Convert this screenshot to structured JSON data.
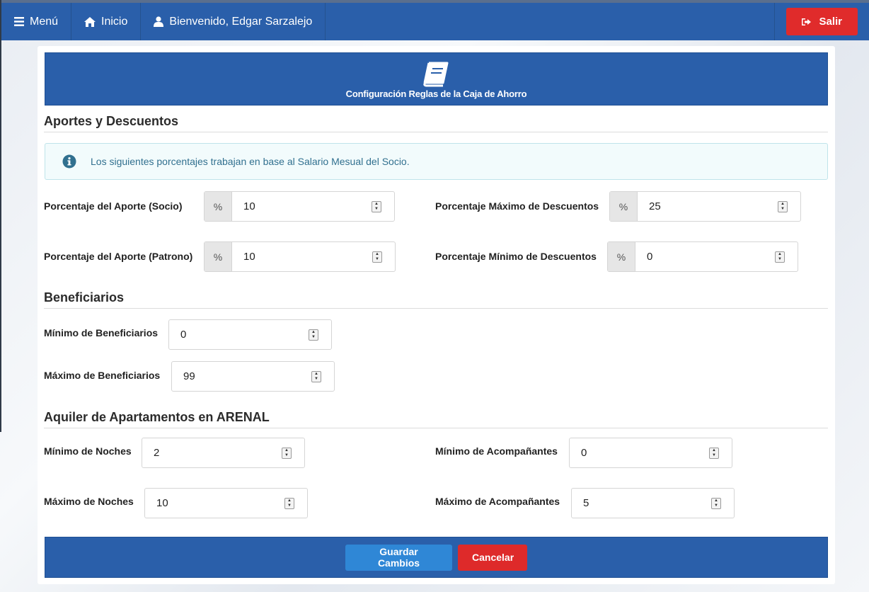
{
  "nav": {
    "menu_label": "Menú",
    "home_label": "Inicio",
    "welcome_label": "Bienvenido, Edgar Sarzalejo",
    "logout_label": "Salir"
  },
  "header": {
    "icon": "book-icon",
    "title": "Configuración Reglas de la Caja de Ahorro"
  },
  "sections": {
    "aportes_title": "Aportes y Descuentos",
    "beneficiarios_title": "Beneficiarios",
    "alquiler_title": "Aquiler de Apartamentos en ARENAL"
  },
  "alert": {
    "icon": "info-icon",
    "text": "Los siguientes porcentajes trabajan en base al Salario Mesual del Socio."
  },
  "fields": {
    "aporte_socio": {
      "label": "Porcentaje del Aporte (Socio)",
      "addon": "%",
      "value": "10"
    },
    "aporte_patrono": {
      "label": "Porcentaje del Aporte (Patrono)",
      "addon": "%",
      "value": "10"
    },
    "max_descuentos": {
      "label": "Porcentaje Máximo de Descuentos",
      "addon": "%",
      "value": "25"
    },
    "min_descuentos": {
      "label": "Porcentaje Mínimo de Descuentos",
      "addon": "%",
      "value": "0"
    },
    "min_beneficiarios": {
      "label": "Mínimo de Beneficiarios",
      "value": "0"
    },
    "max_beneficiarios": {
      "label": "Máximo de Beneficiarios",
      "value": "99"
    },
    "min_noches": {
      "label": "Mínimo de Noches",
      "value": "2"
    },
    "max_noches": {
      "label": "Máximo de Noches",
      "value": "10"
    },
    "min_acompanantes": {
      "label": "Mínimo de Acompañantes",
      "value": "0"
    },
    "max_acompanantes": {
      "label": "Máximo de Acompañantes",
      "value": "5"
    }
  },
  "actions": {
    "save_label": "Guardar Cambios",
    "cancel_label": "Cancelar"
  },
  "colors": {
    "primary": "#2a5faa",
    "danger": "#e02b2b",
    "save": "#2f87d6"
  }
}
